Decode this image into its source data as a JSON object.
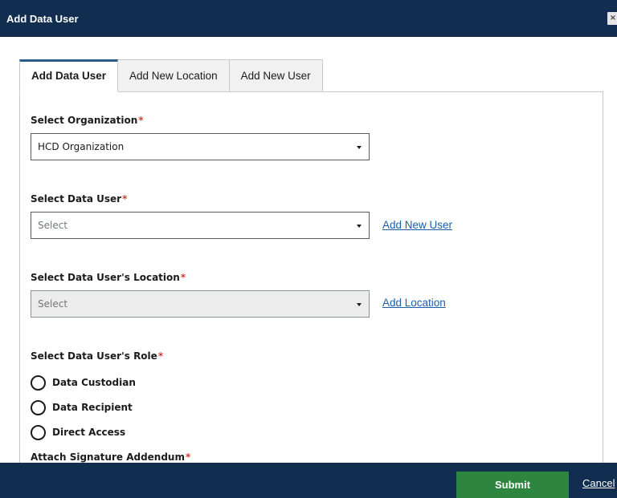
{
  "dialog": {
    "title": "Add Data User",
    "close_glyph": "×"
  },
  "tabs": [
    {
      "label": "Add Data User",
      "active": true
    },
    {
      "label": "Add New Location",
      "active": false
    },
    {
      "label": "Add New User",
      "active": false
    }
  ],
  "form": {
    "organization": {
      "label": "Select Organization",
      "required_mark": "*",
      "value": "HCD Organization"
    },
    "data_user": {
      "label": "Select Data User",
      "required_mark": "*",
      "placeholder": "Select",
      "link": "Add New User"
    },
    "location": {
      "label": "Select Data User's Location",
      "required_mark": "*",
      "placeholder": "Select",
      "disabled": true,
      "link": "Add Location"
    },
    "role": {
      "label": "Select Data User's Role",
      "required_mark": "*",
      "options": [
        {
          "label": "Data Custodian",
          "selected": false
        },
        {
          "label": "Data Recipient",
          "selected": false
        },
        {
          "label": "Direct Access",
          "selected": false
        }
      ]
    },
    "signature": {
      "label": "Attach Signature Addendum",
      "required_mark": "*"
    }
  },
  "footer": {
    "submit_label": "Submit",
    "cancel_label": "Cancel"
  },
  "colors": {
    "header_bg": "#112e51",
    "submit_bg": "#2e8540",
    "link": "#1a5fa8",
    "required": "#d83933",
    "active_tab_border": "#2e5c8a"
  },
  "icons": {
    "close": "close-icon",
    "dropdown": "chevron-down-icon",
    "radio": "radio-unchecked-icon"
  }
}
